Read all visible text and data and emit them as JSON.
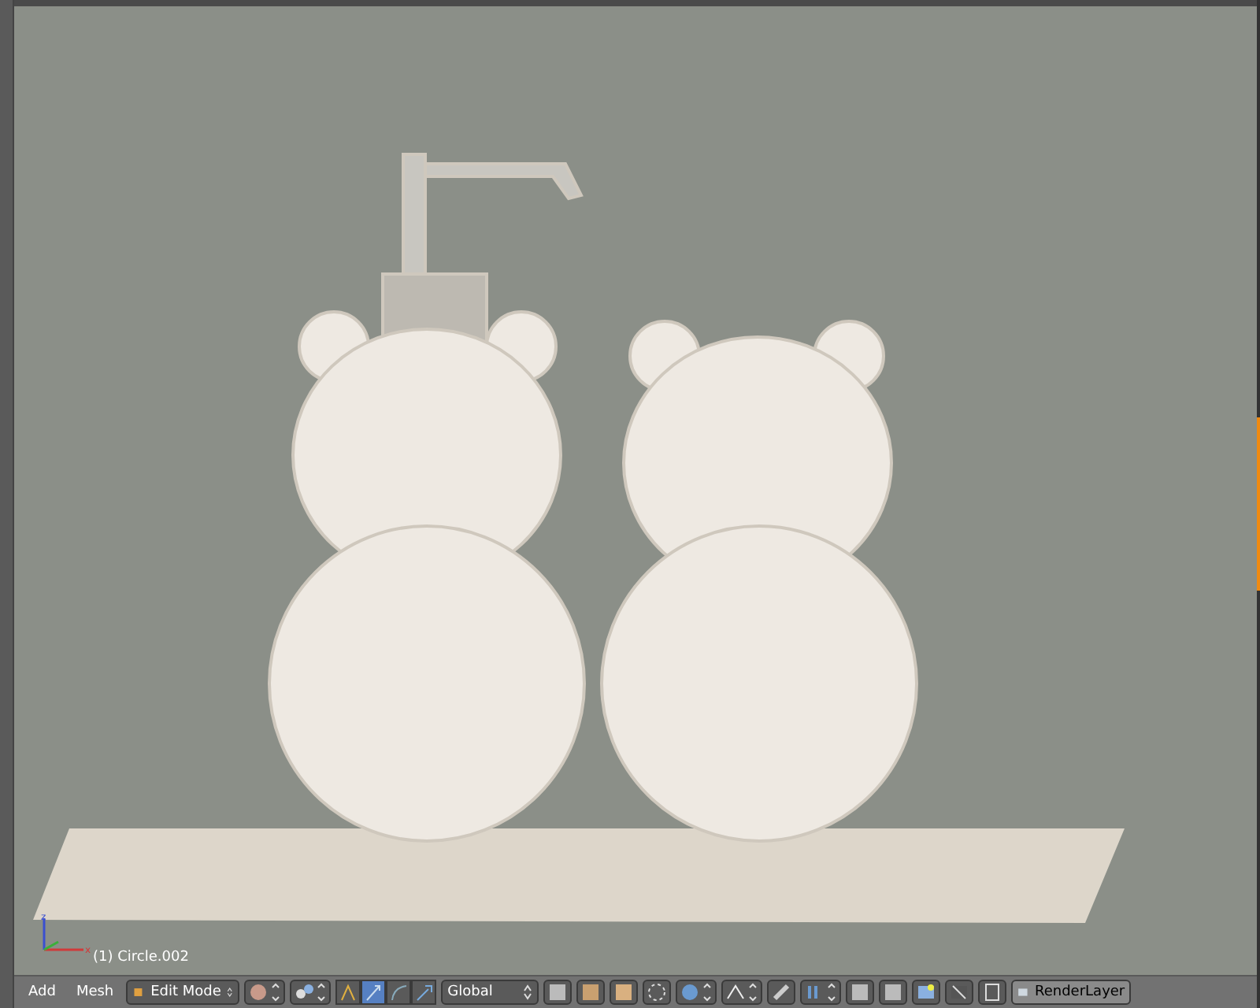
{
  "viewport": {
    "object_label": "(1) Circle.002",
    "axes": {
      "x": "x",
      "z": "z"
    }
  },
  "header": {
    "menus": [
      "Add",
      "Mesh"
    ],
    "mode": {
      "label": "Edit Mode"
    },
    "orientation": {
      "label": "Global"
    },
    "tools": [
      {
        "kind": "manipulator",
        "selected": false
      },
      {
        "kind": "translate",
        "selected": true
      },
      {
        "kind": "rotate",
        "selected": false
      },
      {
        "kind": "scale",
        "selected": false
      }
    ],
    "render_layer": {
      "label": "RenderLayer"
    }
  }
}
